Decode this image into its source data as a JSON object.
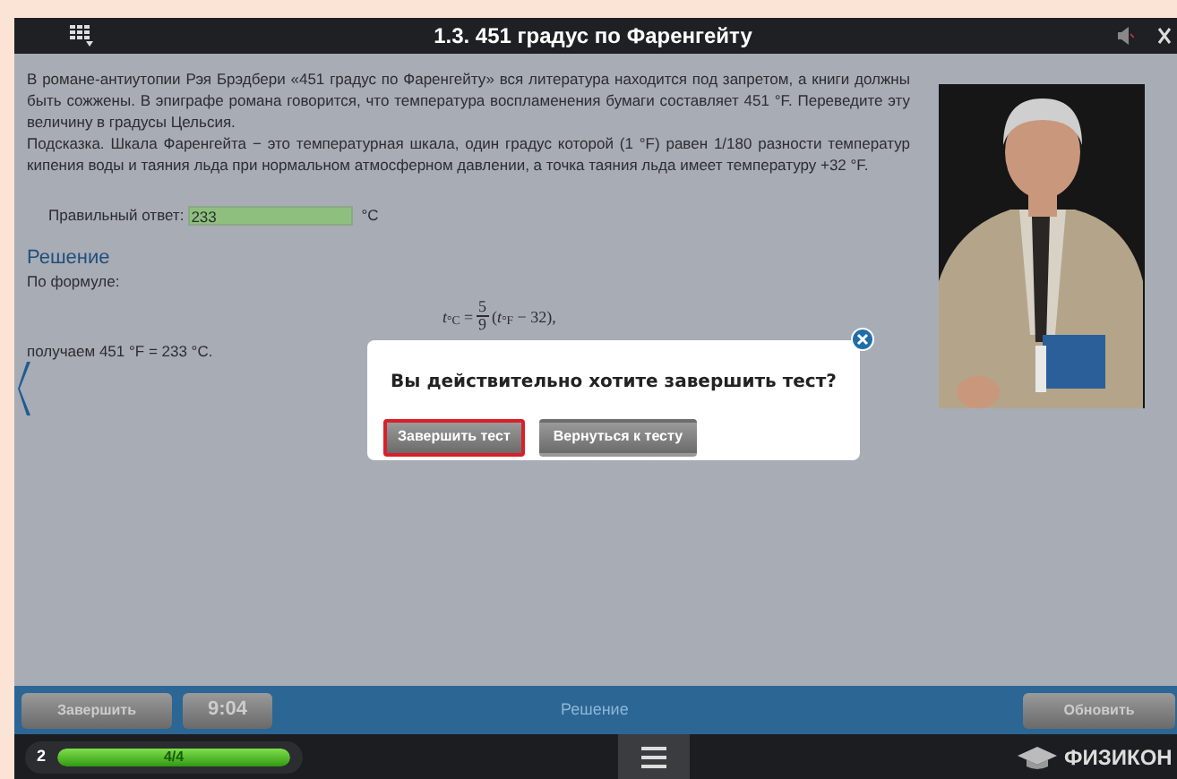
{
  "window": {
    "title": "1.3. 451 градус по Фаренгейту"
  },
  "task": {
    "paragraphs": [
      "В романе-антиутопии Рэя Брэдбери «451 градус по Фаренгейту» вся литература находится под запретом, а книги должны быть сожжены. В эпиграфе романа говорится, что температура воспламенения бумаги составляет 451 °F. Переведите эту величину в градусы Цельсия.",
      "Подсказка. Шкала Фаренгейта − это температурная шкала, один градус которой (1 °F) равен 1/180 разности температур кипения воды и таяния льда при нормальном атмосферном давлении, а точка таяния льда имеет температуру +32 °F."
    ],
    "answer_label": "Правильный ответ:",
    "answer_value": "233",
    "answer_unit": "°C",
    "answer_correct": true
  },
  "solution": {
    "heading": "Решение",
    "intro": "По формуле:",
    "formula": {
      "left": "*t*$_{°C}$ =",
      "numerator": "5",
      "denominator": "9",
      "right": "(*t*$_{°F}$ − 32),"
    },
    "result": "получаем 451 °F = 233 °C."
  },
  "dialog": {
    "question": "Вы действительно хотите завершить тест?",
    "buttons": [
      {
        "label": "Завершить тест",
        "selected": true
      },
      {
        "label": "Вернуться к тесту",
        "selected": false
      }
    ]
  },
  "toolbar": {
    "finish": "Завершить",
    "timer": "9:04",
    "center": "Решение",
    "refresh": "Обновить"
  },
  "status_bar": {
    "number": "2",
    "progress": {
      "label": "4/4",
      "level": 1
    },
    "logo": "ФИЗИКОН"
  }
}
